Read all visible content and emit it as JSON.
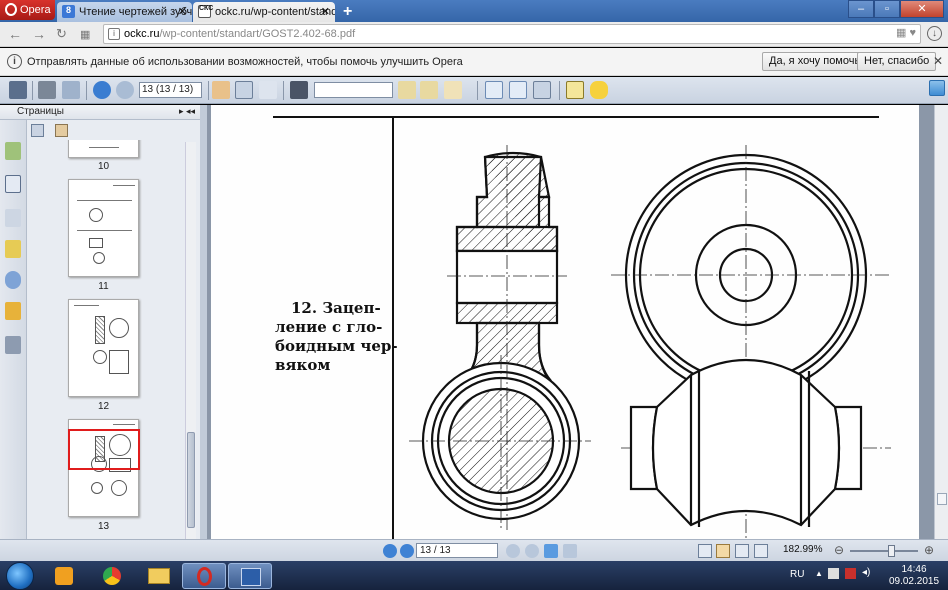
{
  "browser": {
    "opera_label": "Opera",
    "tabs": [
      {
        "title": "Чтение чертежей зубчатых",
        "favicon": "8",
        "active": false
      },
      {
        "title": "ockc.ru/wp-content/standart",
        "favicon": "СКС",
        "active": true
      }
    ],
    "new_tab_label": "+",
    "url_host": "ockc.ru",
    "url_path": "/wp-content/standart/GOST2.402-68.pdf"
  },
  "notification": {
    "message": "Отправлять данные об использовании возможностей, чтобы помочь улучшить Opera",
    "accept_label": "Да, я хочу помочь",
    "decline_label": "Нет, спасибо"
  },
  "pdf_toolbar": {
    "page_field": "13 (13 / 13)",
    "search_value": ""
  },
  "sidebar": {
    "title": "Страницы",
    "thumbnails": [
      {
        "label": "10",
        "selected": false
      },
      {
        "label": "11",
        "selected": false
      },
      {
        "label": "12",
        "selected": false
      },
      {
        "label": "13",
        "selected": true
      }
    ]
  },
  "document": {
    "caption_lines": [
      "12. Зацеп-",
      "ление с гло-",
      "боидным чер-",
      "вяком"
    ]
  },
  "status_bar": {
    "page_display": "13 / 13",
    "zoom": "182.99%"
  },
  "taskbar": {
    "language": "RU",
    "time": "14:46",
    "date": "09.02.2015"
  },
  "colors": {
    "selection_border": "#e01c1c",
    "titlebar": "#3566a8",
    "opera_red": "#c1251f"
  }
}
